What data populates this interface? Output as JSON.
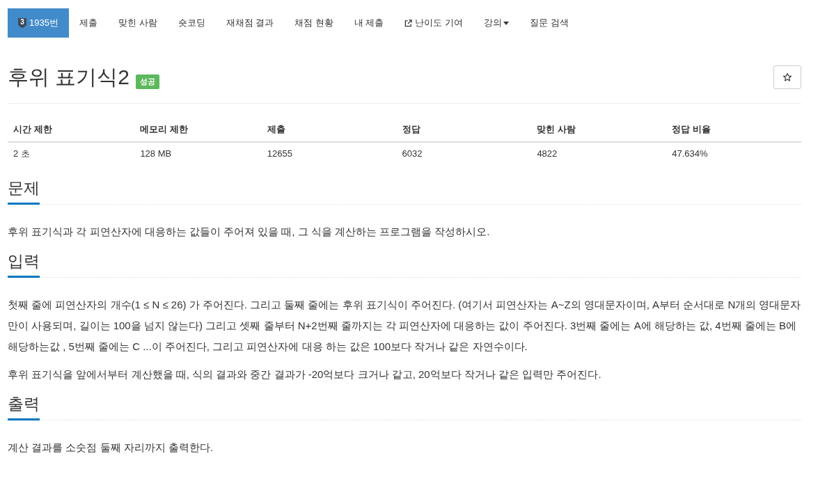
{
  "nav": {
    "tabs": [
      {
        "kind": "problem",
        "tier": "3",
        "label": "1935번",
        "selected": true
      },
      {
        "kind": "plain",
        "label": "제출",
        "selected": false
      },
      {
        "kind": "plain",
        "label": "맞힌 사람",
        "selected": false
      },
      {
        "kind": "plain",
        "label": "숏코딩",
        "selected": false
      },
      {
        "kind": "plain",
        "label": "재채점 결과",
        "selected": false
      },
      {
        "kind": "plain",
        "label": "채점 현황",
        "selected": false
      },
      {
        "kind": "plain",
        "label": "내 제출",
        "selected": false
      },
      {
        "kind": "external",
        "label": "난이도 기여",
        "selected": false
      },
      {
        "kind": "dropdown",
        "label": "강의",
        "selected": false
      },
      {
        "kind": "plain",
        "label": "질문 검색",
        "selected": false
      }
    ]
  },
  "problem": {
    "title": "후위 표기식2",
    "result_badge": "성공"
  },
  "info_table": {
    "columns": [
      "시간 제한",
      "메모리 제한",
      "제출",
      "정답",
      "맞힌 사람",
      "정답 비율"
    ],
    "rows": [
      [
        "2 초",
        "128 MB",
        "12655",
        "6032",
        "4822",
        "47.634%"
      ]
    ]
  },
  "sections": [
    {
      "heading": "문제",
      "paragraphs": [
        "후위 표기식과 각 피연산자에 대응하는 값들이 주어져 있을 때, 그 식을 계산하는 프로그램을 작성하시오."
      ]
    },
    {
      "heading": "입력",
      "paragraphs": [
        "첫째 줄에 피연산자의 개수(1 ≤ N ≤ 26) 가 주어진다. 그리고 둘째 줄에는 후위 표기식이 주어진다. (여기서 피연산자는 A~Z의 영대문자이며, A부터 순서대로 N개의 영대문자만이 사용되며, 길이는 100을 넘지 않는다) 그리고 셋째 줄부터 N+2번째 줄까지는 각 피연산자에 대응하는 값이 주어진다. 3번째 줄에는 A에 해당하는 값, 4번째 줄에는 B에 해당하는값 , 5번째 줄에는 C ...이 주어진다, 그리고 피연산자에 대응 하는 값은 100보다 작거나 같은 자연수이다.",
        "후위 표기식을 앞에서부터 계산했을 때, 식의 결과와 중간 결과가 -20억보다 크거나 같고, 20억보다 작거나 같은 입력만 주어진다."
      ]
    },
    {
      "heading": "출력",
      "paragraphs": [
        "계산 결과를 소숫점 둘째 자리까지 출력한다."
      ]
    }
  ]
}
